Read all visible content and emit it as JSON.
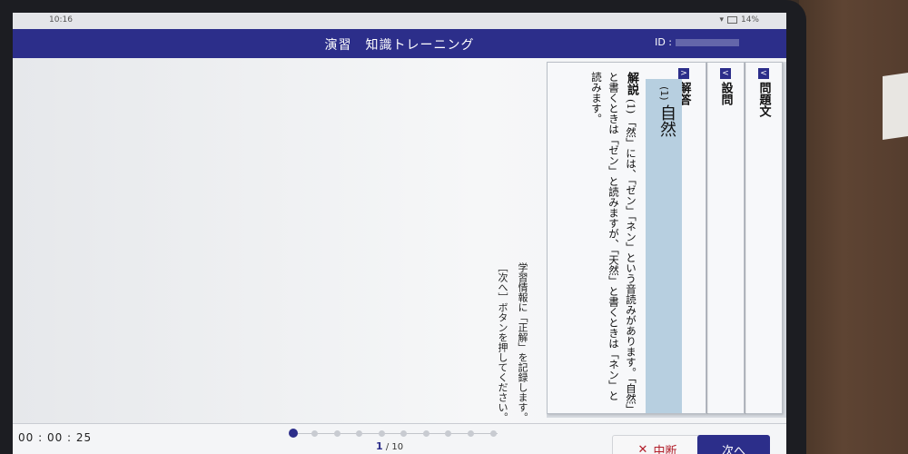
{
  "status_bar": {
    "time": "10:16",
    "battery": "14%"
  },
  "header": {
    "title": "演習　知識トレーニング",
    "id_label": "ID :"
  },
  "instructions": {
    "line1": "学習情報に「正解」を記録します。",
    "line2": "［次へ］ボタンを押してください。"
  },
  "tabs": [
    {
      "label": "問題文",
      "icon": "chevron-left-icon"
    },
    {
      "label": "設問",
      "icon": "chevron-left-icon"
    },
    {
      "label": "解答",
      "icon": "chevron-right-icon"
    }
  ],
  "answer": {
    "number": "(1)",
    "word": "自然"
  },
  "explanation": {
    "heading": "解説",
    "number": "(1)",
    "text": "「然」には、「ゼン」「ネン」という音読みがあります。「自然」と書くときは「ゼン」と読みますが、「天然」と書くときは「ネン」と読みます。"
  },
  "footer": {
    "timer": "00 : 00 : 25",
    "current_page": "1",
    "separator": "/",
    "total_pages": "10",
    "stop_label": "中断",
    "next_label": "次へ"
  },
  "colors": {
    "accent": "#2c2e8a",
    "answer_bg": "#b7cfe0",
    "stop_red": "#b21e2a"
  }
}
